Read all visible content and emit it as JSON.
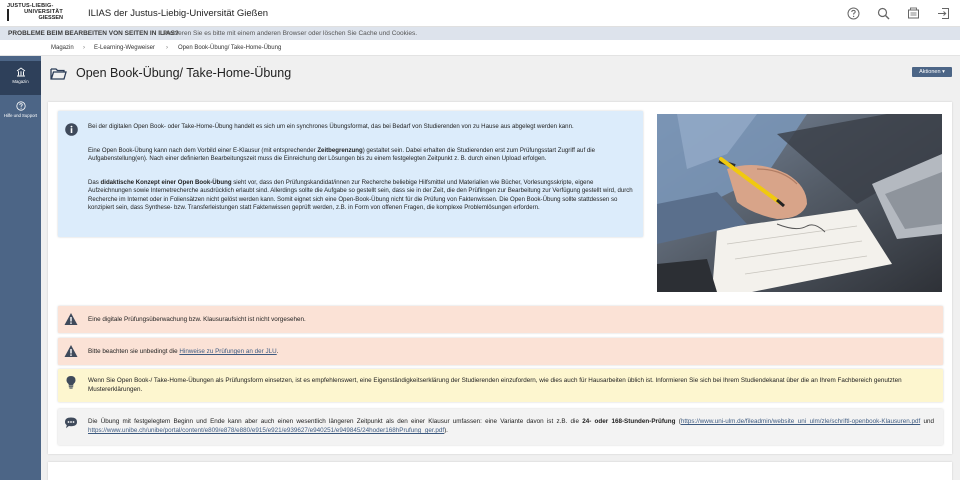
{
  "header": {
    "logo_lines": [
      "JUSTUS-LIEBIG-",
      "UNIVERSITÄT",
      "GIESSEN"
    ],
    "app_title": "ILIAS der Justus-Liebig-Universität Gießen",
    "icons": [
      "help-icon",
      "search-icon",
      "notifications-icon",
      "logout-icon"
    ]
  },
  "alert": {
    "title": "PROBLEME BEIM BEARBEITEN VON SEITEN IN ILIAS?",
    "text": "Probieren Sie es bitte mit einem anderen Browser oder löschen Sie Cache und Cookies."
  },
  "breadcrumb": [
    "Magazin",
    "E-Learning-Wegweiser",
    "Open Book-Übung/ Take-Home-Übung"
  ],
  "sidebar": [
    {
      "label": "Magazin",
      "icon": "repository-icon"
    },
    {
      "label": "Hilfe und Support",
      "icon": "help-icon"
    }
  ],
  "page": {
    "title": "Open Book-Übung/ Take-Home-Übung",
    "actions_label": "Aktionen ▾"
  },
  "info": {
    "p1": "Bei der digitalen Open Book- oder Take-Home-Übung handelt es sich um ein synchrones Übungsformat, das bei Bedarf von Studierenden von zu Hause aus abgelegt werden kann.",
    "p2_a": "Eine Open Book-Übung kann nach dem Vorbild einer E-Klausur (mit entsprechender ",
    "p2_b": "Zeitbegrenzung",
    "p2_c": ") gestaltet sein. Dabei erhalten die Studierenden erst zum Prüfungsstart Zugriff auf die Aufgabenstellung(en). Nach einer definierten Bearbeitungszeit muss die Einreichung der Lösungen bis zu einem festgelegten Zeitpunkt z. B. durch einen Upload erfolgen.",
    "p3_a": "Das ",
    "p3_b": "didaktische Konzept einer Open Book-Übung",
    "p3_c": " sieht vor, dass den Prüfungskandidat/innen zur Recherche beliebige Hilfsmittel und Materialien wie Bücher, Vorlesungsskripte, eigene Aufzeichnungen sowie Internetrecherche ausdrücklich erlaubt sind. Allerdings sollte die Aufgabe so gestellt sein, dass sie in der Zeit, die den Prüflingen zur Bearbeitung zur Verfügung gestellt wird, durch Recherche im Internet oder in Foliensätzen nicht gelöst werden kann. Somit eignet sich eine Open-Book-Übung nicht für die Prüfung von Faktenwissen. Die Open Book-Übung sollte stattdessen so konzipiert sein, dass Synthese- bzw. Transferleistungen statt Faktenwissen geprüft werden, z.B. in Form von offenen Fragen, die komplexe Problemlösungen erfordern."
  },
  "warnings": {
    "w1": "Eine digitale Prüfungsüberwachung bzw. Klausuraufsicht ist nicht vorgesehen.",
    "w2_pre": "Bitte beachten sie unbedingt die ",
    "w2_link": "Hinweise zu Prüfungen an der JLU",
    "w2_post": "."
  },
  "tip": {
    "text": "Wenn Sie Open Book-/ Take-Home-Übungen als Prüfungsform einsetzen, ist es empfehlenswert, eine Eigenständigkeitserklärung der Studierenden einzufordern, wie dies auch für Hausarbeiten üblich ist. Informieren Sie sich bei Ihrem Studiendekanat über die an Ihrem Fachbereich genutzten Mustererklärungen."
  },
  "note": {
    "text_a": "Die Übung mit festgelegtem Beginn und Ende kann aber auch einen wesentlich längeren Zeitpunkt als den einer Klausur umfassen: eine Variante davon ist z.B. die ",
    "text_b": "24- oder 168-Stunden-Prüfung",
    "text_c": " (",
    "link1": "https://www.uni-ulm.de/fileadmin/website_uni_ulm/zle/schriftl-openbook-Klausuren.pdf",
    "text_d": " und ",
    "link2": "https://www.unibe.ch/unibe/portal/content/e809/e878/e880/e915/e921/e939627/e940251/e949845/24hoder168hPrufung_ger.pdf",
    "text_e": ")."
  },
  "colors": {
    "sidebar": "#4c6586",
    "info_bg": "#dcecfb",
    "warning_bg": "#fbe2d6",
    "tip_bg": "#fdf6cf",
    "link": "#3d5a80"
  }
}
